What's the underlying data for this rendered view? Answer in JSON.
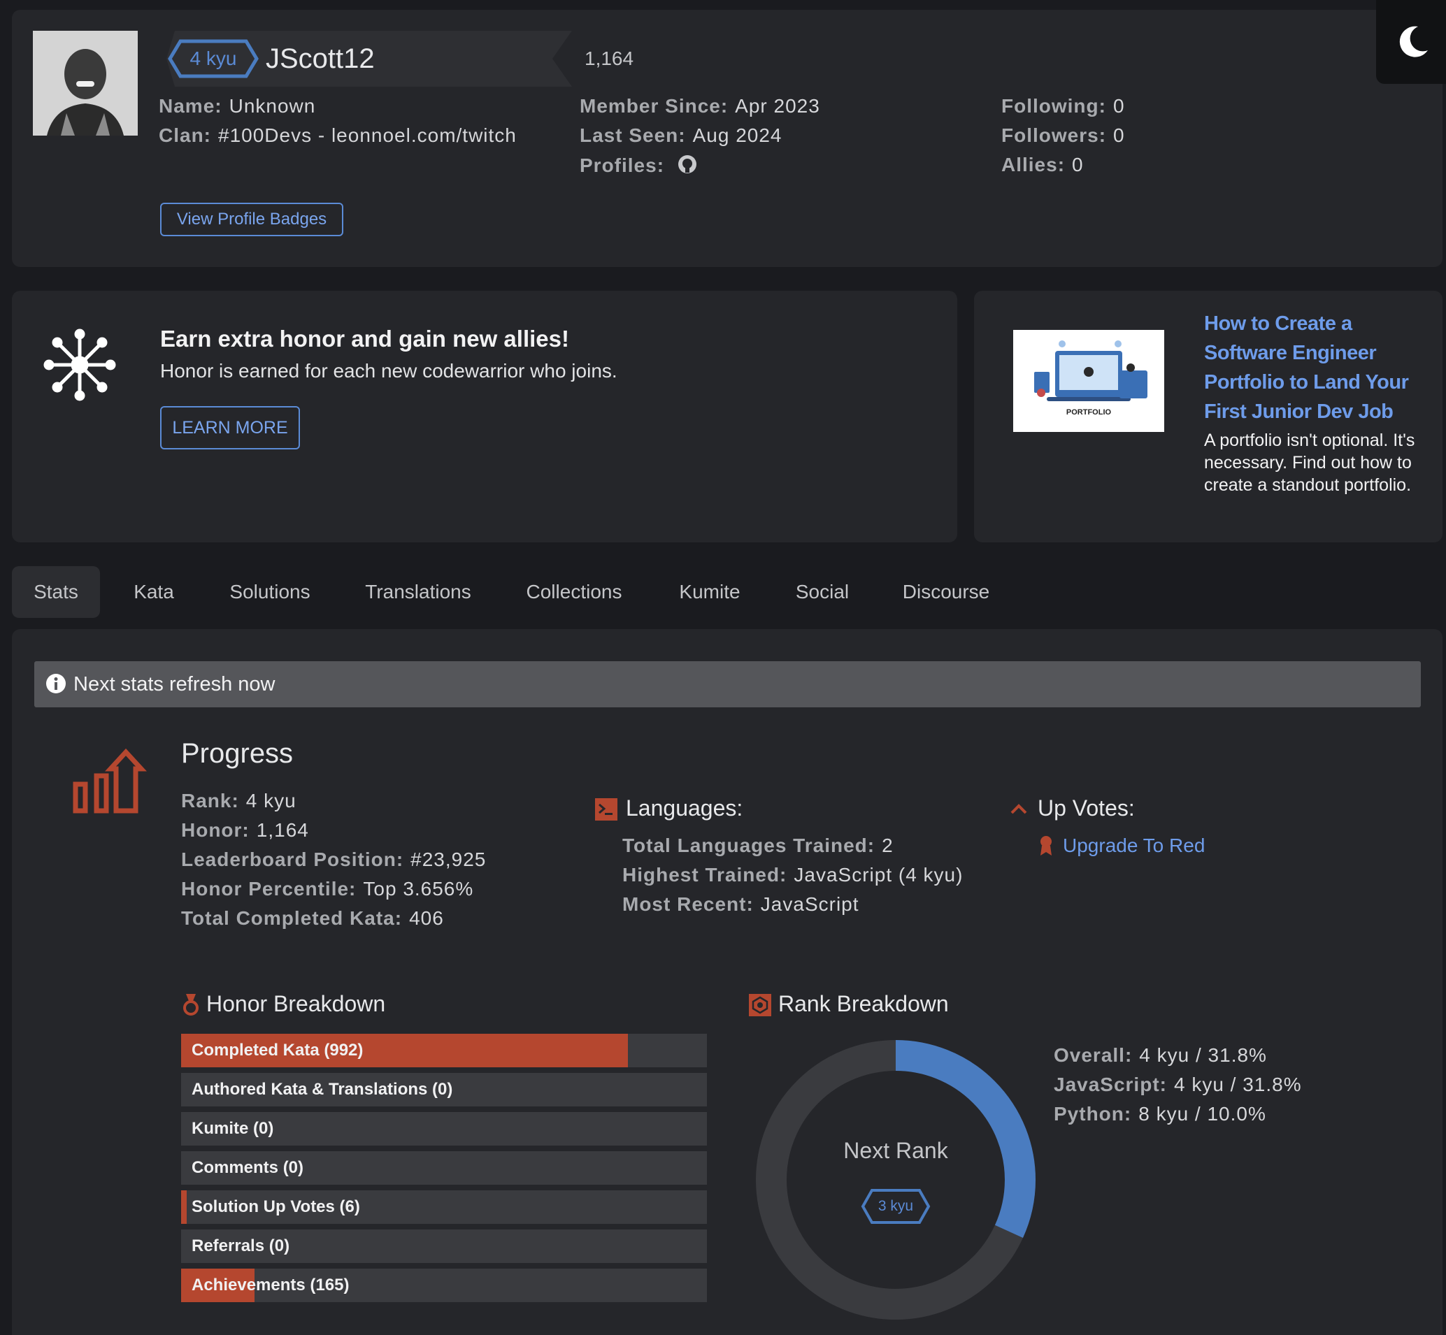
{
  "profile": {
    "rank_badge": "4 kyu",
    "username": "JScott12",
    "honor": "1,164",
    "name_label": "Name:",
    "name_value": "Unknown",
    "clan_label": "Clan:",
    "clan_value": "#100Devs - leonnoel.com/twitch",
    "member_since_label": "Member Since:",
    "member_since_value": "Apr 2023",
    "last_seen_label": "Last Seen:",
    "last_seen_value": "Aug 2024",
    "profiles_label": "Profiles:",
    "following_label": "Following:",
    "following_value": "0",
    "followers_label": "Followers:",
    "followers_value": "0",
    "allies_label": "Allies:",
    "allies_value": "0",
    "badges_button": "View Profile Badges"
  },
  "promo": {
    "title": "Earn extra honor and gain new allies!",
    "subtitle": "Honor is earned for each new codewarrior who joins.",
    "button": "LEARN MORE"
  },
  "article": {
    "image_caption": "PORTFOLIO",
    "title": "How to Create a Software Engineer Portfolio to Land Your First Junior Dev Job",
    "description": "A portfolio isn't optional. It's necessary. Find out how to create a standout portfolio."
  },
  "tabs": [
    "Stats",
    "Kata",
    "Solutions",
    "Translations",
    "Collections",
    "Kumite",
    "Social",
    "Discourse"
  ],
  "notice": "Next stats refresh now",
  "progress": {
    "heading": "Progress",
    "rank_label": "Rank:",
    "rank_value": "4 kyu",
    "honor_label": "Honor:",
    "honor_value": "1,164",
    "leaderboard_label": "Leaderboard Position:",
    "leaderboard_value": "#23,925",
    "percentile_label": "Honor Percentile:",
    "percentile_value": "Top 3.656%",
    "completed_label": "Total Completed Kata:",
    "completed_value": "406"
  },
  "languages": {
    "heading": "Languages:",
    "trained_label": "Total Languages Trained:",
    "trained_value": "2",
    "highest_label": "Highest Trained:",
    "highest_value": "JavaScript (4 kyu)",
    "recent_label": "Most Recent:",
    "recent_value": "JavaScript"
  },
  "upvotes": {
    "heading": "Up Votes:",
    "link": "Upgrade To Red"
  },
  "honor_breakdown": {
    "heading": "Honor Breakdown",
    "items": [
      {
        "label": "Completed Kata (992)",
        "fill": 0.85
      },
      {
        "label": "Authored Kata & Translations (0)",
        "fill": 0
      },
      {
        "label": "Kumite (0)",
        "fill": 0
      },
      {
        "label": "Comments (0)",
        "fill": 0
      },
      {
        "label": "Solution Up Votes (6)",
        "fill": 0.01
      },
      {
        "label": "Referrals (0)",
        "fill": 0
      },
      {
        "label": "Achievements (165)",
        "fill": 0.14
      }
    ]
  },
  "rank_breakdown": {
    "heading": "Rank Breakdown",
    "center_label": "Next Rank",
    "next_rank_badge": "3 kyu",
    "progress": 0.318,
    "overall_label": "Overall:",
    "overall_value": "4 kyu / 31.8%",
    "js_label": "JavaScript:",
    "js_value": "4 kyu / 31.8%",
    "py_label": "Python:",
    "py_value": "8 kyu / 10.0%"
  },
  "colors": {
    "accent_red": "#b5472f",
    "accent_blue": "#4a7cc0",
    "link_blue": "#6e9cea"
  }
}
